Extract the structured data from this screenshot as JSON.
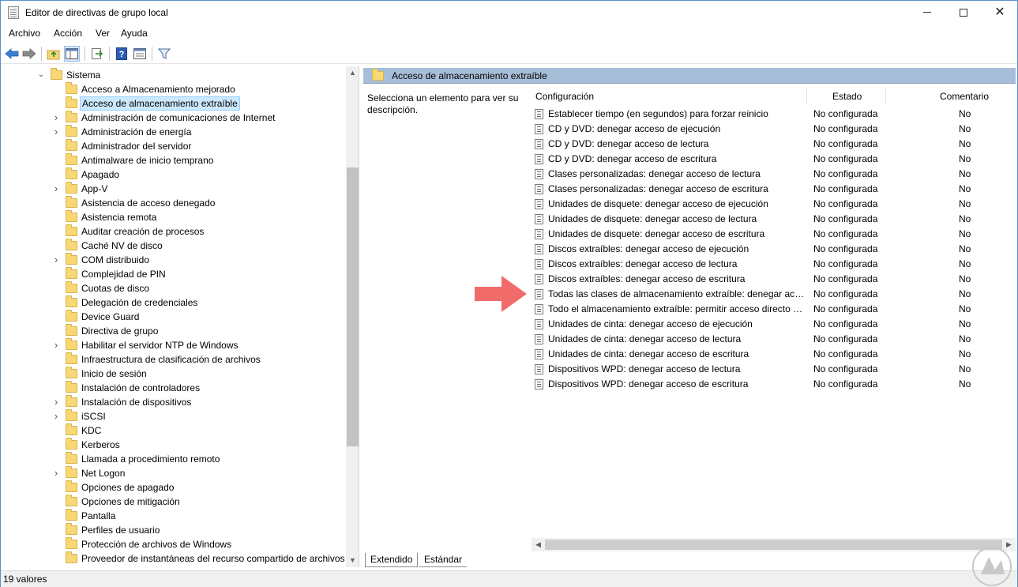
{
  "window": {
    "title": "Editor de directivas de grupo local"
  },
  "menu": [
    "Archivo",
    "Acción",
    "Ver",
    "Ayuda"
  ],
  "tree": {
    "parent": "Sistema",
    "items": [
      {
        "label": "Acceso a Almacenamiento mejorado",
        "expandable": false,
        "selected": false
      },
      {
        "label": "Acceso de almacenamiento extraíble",
        "expandable": false,
        "selected": true
      },
      {
        "label": "Administración de comunicaciones de Internet",
        "expandable": true,
        "selected": false
      },
      {
        "label": "Administración de energía",
        "expandable": true,
        "selected": false
      },
      {
        "label": "Administrador del servidor",
        "expandable": false,
        "selected": false
      },
      {
        "label": "Antimalware de inicio temprano",
        "expandable": false,
        "selected": false
      },
      {
        "label": "Apagado",
        "expandable": false,
        "selected": false
      },
      {
        "label": "App-V",
        "expandable": true,
        "selected": false
      },
      {
        "label": "Asistencia de acceso denegado",
        "expandable": false,
        "selected": false
      },
      {
        "label": "Asistencia remota",
        "expandable": false,
        "selected": false
      },
      {
        "label": "Auditar creación de procesos",
        "expandable": false,
        "selected": false
      },
      {
        "label": "Caché NV de disco",
        "expandable": false,
        "selected": false
      },
      {
        "label": "COM distribuido",
        "expandable": true,
        "selected": false
      },
      {
        "label": "Complejidad de PIN",
        "expandable": false,
        "selected": false
      },
      {
        "label": "Cuotas de disco",
        "expandable": false,
        "selected": false
      },
      {
        "label": "Delegación de credenciales",
        "expandable": false,
        "selected": false
      },
      {
        "label": "Device Guard",
        "expandable": false,
        "selected": false
      },
      {
        "label": "Directiva de grupo",
        "expandable": false,
        "selected": false
      },
      {
        "label": "Habilitar el servidor NTP de Windows",
        "expandable": true,
        "selected": false
      },
      {
        "label": "Infraestructura de clasificación de archivos",
        "expandable": false,
        "selected": false
      },
      {
        "label": "Inicio de sesión",
        "expandable": false,
        "selected": false
      },
      {
        "label": "Instalación de controladores",
        "expandable": false,
        "selected": false
      },
      {
        "label": "Instalación de dispositivos",
        "expandable": true,
        "selected": false
      },
      {
        "label": "iSCSI",
        "expandable": true,
        "selected": false
      },
      {
        "label": "KDC",
        "expandable": false,
        "selected": false
      },
      {
        "label": "Kerberos",
        "expandable": false,
        "selected": false
      },
      {
        "label": "Llamada a procedimiento remoto",
        "expandable": false,
        "selected": false
      },
      {
        "label": "Net Logon",
        "expandable": true,
        "selected": false
      },
      {
        "label": "Opciones de apagado",
        "expandable": false,
        "selected": false
      },
      {
        "label": "Opciones de mitigación",
        "expandable": false,
        "selected": false
      },
      {
        "label": "Pantalla",
        "expandable": false,
        "selected": false
      },
      {
        "label": "Perfiles de usuario",
        "expandable": false,
        "selected": false
      },
      {
        "label": "Protección de archivos de Windows",
        "expandable": false,
        "selected": false
      },
      {
        "label": "Proveedor de instantáneas del recurso compartido de archivos",
        "expandable": false,
        "selected": false
      }
    ]
  },
  "details": {
    "header_title": "Acceso de almacenamiento extraíble",
    "description": "Selecciona un elemento para ver su descripción.",
    "columns": {
      "name": "Configuración",
      "state": "Estado",
      "comment": "Comentario"
    },
    "policies": [
      {
        "name": "Establecer tiempo (en segundos) para forzar reinicio",
        "state": "No configurada",
        "comment": "No"
      },
      {
        "name": "CD y DVD: denegar acceso de ejecución",
        "state": "No configurada",
        "comment": "No"
      },
      {
        "name": "CD y DVD: denegar acceso de lectura",
        "state": "No configurada",
        "comment": "No"
      },
      {
        "name": "CD y DVD: denegar acceso de escritura",
        "state": "No configurada",
        "comment": "No"
      },
      {
        "name": "Clases personalizadas: denegar acceso de lectura",
        "state": "No configurada",
        "comment": "No"
      },
      {
        "name": "Clases personalizadas: denegar acceso de escritura",
        "state": "No configurada",
        "comment": "No"
      },
      {
        "name": "Unidades de disquete: denegar acceso de ejecución",
        "state": "No configurada",
        "comment": "No"
      },
      {
        "name": "Unidades de disquete: denegar acceso de lectura",
        "state": "No configurada",
        "comment": "No"
      },
      {
        "name": "Unidades de disquete: denegar acceso de escritura",
        "state": "No configurada",
        "comment": "No"
      },
      {
        "name": "Discos extraíbles: denegar acceso de ejecución",
        "state": "No configurada",
        "comment": "No"
      },
      {
        "name": "Discos extraíbles: denegar acceso de lectura",
        "state": "No configurada",
        "comment": "No"
      },
      {
        "name": "Discos extraíbles: denegar acceso de escritura",
        "state": "No configurada",
        "comment": "No"
      },
      {
        "name": "Todas las clases de almacenamiento extraíble: denegar acce...",
        "state": "No configurada",
        "comment": "No"
      },
      {
        "name": "Todo el almacenamiento extraíble: permitir acceso directo e...",
        "state": "No configurada",
        "comment": "No"
      },
      {
        "name": "Unidades de cinta: denegar acceso de ejecución",
        "state": "No configurada",
        "comment": "No"
      },
      {
        "name": "Unidades de cinta: denegar acceso de lectura",
        "state": "No configurada",
        "comment": "No"
      },
      {
        "name": "Unidades de cinta: denegar acceso de escritura",
        "state": "No configurada",
        "comment": "No"
      },
      {
        "name": "Dispositivos WPD: denegar acceso de lectura",
        "state": "No configurada",
        "comment": "No"
      },
      {
        "name": "Dispositivos WPD: denegar acceso de escritura",
        "state": "No configurada",
        "comment": "No"
      }
    ],
    "tabs": [
      "Extendido",
      "Estándar"
    ]
  },
  "status": {
    "text": "19 valores"
  },
  "toolbar_icons": [
    "back-arrow-icon",
    "forward-arrow-icon",
    "up-folder-icon",
    "show-hide-tree-icon",
    "export-list-icon",
    "help-icon",
    "properties-icon",
    "filter-icon"
  ],
  "colors": {
    "header_bar": "#a7bed8",
    "selection": "#cce8ff",
    "annotation_arrow": "#f26b6b",
    "window_border": "#5a8fcf"
  }
}
